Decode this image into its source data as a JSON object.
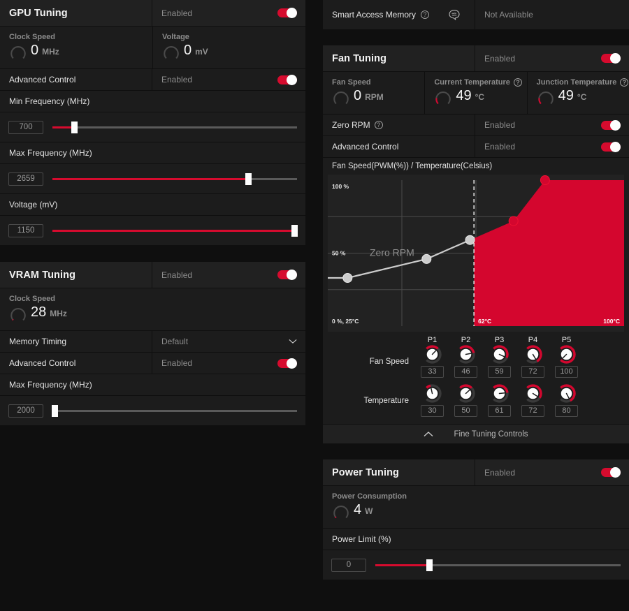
{
  "smart_access_memory": {
    "label": "Smart Access Memory",
    "help_icon": "question-icon",
    "brain_icon": "brain-icon",
    "status": "Not Available"
  },
  "gpu_tuning": {
    "title": "GPU Tuning",
    "state": "Enabled",
    "metrics": [
      {
        "label": "Clock Speed",
        "value": "0",
        "unit": "MHz",
        "gauge_pct": 0
      },
      {
        "label": "Voltage",
        "value": "0",
        "unit": "mV",
        "gauge_pct": 0
      }
    ],
    "advanced_control": {
      "label": "Advanced Control",
      "state": "Enabled"
    },
    "sliders": [
      {
        "label": "Min Frequency (MHz)",
        "value": "700",
        "pct": 9
      },
      {
        "label": "Max Frequency (MHz)",
        "value": "2659",
        "pct": 80
      },
      {
        "label": "Voltage (mV)",
        "value": "1150",
        "pct": 99
      }
    ]
  },
  "vram_tuning": {
    "title": "VRAM Tuning",
    "state": "Enabled",
    "metrics": [
      {
        "label": "Clock Speed",
        "value": "28",
        "unit": "MHz",
        "gauge_pct": 2
      }
    ],
    "memory_timing": {
      "label": "Memory Timing",
      "value": "Default",
      "icon": "chevron-down-icon"
    },
    "advanced_control": {
      "label": "Advanced Control",
      "state": "Enabled"
    },
    "sliders": [
      {
        "label": "Max Frequency (MHz)",
        "value": "2000",
        "pct": 1
      }
    ]
  },
  "fan_tuning": {
    "title": "Fan Tuning",
    "state": "Enabled",
    "metrics": [
      {
        "label": "Fan Speed",
        "value": "0",
        "unit": "RPM",
        "gauge_pct": 0,
        "help": false
      },
      {
        "label": "Current Temperature",
        "value": "49",
        "unit": "°C",
        "gauge_pct": 45,
        "help": true
      },
      {
        "label": "Junction Temperature",
        "value": "49",
        "unit": "°C",
        "gauge_pct": 45,
        "help": true
      }
    ],
    "zero_rpm": {
      "label": "Zero RPM",
      "state": "Enabled",
      "help": true
    },
    "advanced_control": {
      "label": "Advanced Control",
      "state": "Enabled"
    },
    "fine_tuning": {
      "label": "Fine Tuning Controls",
      "icon": "chevron-up-icon"
    },
    "point_header": [
      "P1",
      "P2",
      "P3",
      "P4",
      "P5"
    ],
    "fan_speed_label": "Fan Speed",
    "temperature_label": "Temperature",
    "fan_speed_values": [
      "33",
      "46",
      "59",
      "72",
      "100"
    ],
    "temperature_values": [
      "30",
      "50",
      "61",
      "72",
      "80"
    ]
  },
  "power_tuning": {
    "title": "Power Tuning",
    "state": "Enabled",
    "metrics": [
      {
        "label": "Power Consumption",
        "value": "4",
        "unit": "W",
        "gauge_pct": 3
      }
    ],
    "sliders": [
      {
        "label": "Power Limit (%)",
        "value": "0",
        "pct": 22
      }
    ]
  },
  "chart_data": {
    "type": "line",
    "title": "Fan Speed(PWM(%)) / Temperature(Celsius)",
    "xlabel": "Temperature(Celsius)",
    "ylabel": "Fan Speed(PWM(%))",
    "xlim": [
      25,
      100
    ],
    "ylim": [
      0,
      100
    ],
    "x_tick_labels": [
      "0 %, 25°C",
      "62°C",
      "100°C"
    ],
    "y_tick_labels": [
      "100 %",
      "50 %"
    ],
    "grid": true,
    "zero_rpm_annotation": "Zero RPM",
    "zero_rpm_threshold_temp": 62,
    "categories": [
      "P1",
      "P2",
      "P3",
      "P4",
      "P5"
    ],
    "series": [
      {
        "name": "Fan Speed (PWM %)",
        "x": [
          30,
          50,
          61,
          72,
          80
        ],
        "values": [
          33,
          46,
          59,
          72,
          100
        ]
      }
    ],
    "colors": {
      "active": "#d4062e",
      "zero_rpm": "#cccccc",
      "grid": "#4a4a4a"
    }
  },
  "theme": {
    "accent": "#d60b2e",
    "panel": "#1c1c1c",
    "panel_header": "#212121",
    "page_bg": "#0f0f0f"
  }
}
